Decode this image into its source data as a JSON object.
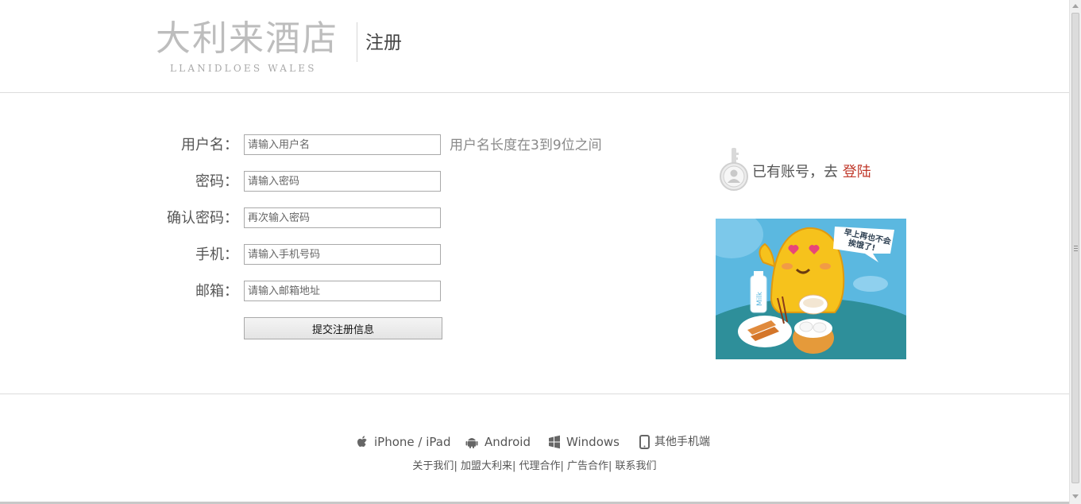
{
  "header": {
    "logo_cn": "大利来酒店",
    "logo_en": "LLANIDLOES WALES",
    "title": "注册"
  },
  "form": {
    "fields": [
      {
        "label": "用户名：",
        "placeholder": "请输入用户名",
        "value": ""
      },
      {
        "label": "密码：",
        "placeholder": "请输入密码",
        "value": ""
      },
      {
        "label": "确认密码：",
        "placeholder": "再次输入密码",
        "value": ""
      },
      {
        "label": "手机：",
        "placeholder": "请输入手机号码",
        "value": ""
      },
      {
        "label": "邮箱：",
        "placeholder": "请输入邮箱地址",
        "value": ""
      }
    ],
    "username_hint": "用户名长度在3到9位之间",
    "submit_label": "提交注册信息"
  },
  "login": {
    "prompt": "已有账号，去 ",
    "link_label": "登陆",
    "icon": "key-user-icon"
  },
  "promo": {
    "bubble_line1": "早上再也不会",
    "bubble_line2": "挨饿了!",
    "milk_label": "Milk"
  },
  "footer": {
    "platforms": [
      {
        "label": "iPhone / iPad",
        "icon": "apple-icon"
      },
      {
        "label": "Android",
        "icon": "android-icon"
      },
      {
        "label": "Windows",
        "icon": "windows-icon"
      },
      {
        "label": "其他手机端",
        "icon": "phone-icon"
      }
    ],
    "links": [
      "关于我们",
      "加盟大利来",
      "代理合作",
      "广告合作",
      "联系我们"
    ]
  },
  "colors": {
    "accent_link": "#c0392b",
    "promo_bg": "#5bb8e0",
    "promo_table": "#2e8f9a"
  }
}
